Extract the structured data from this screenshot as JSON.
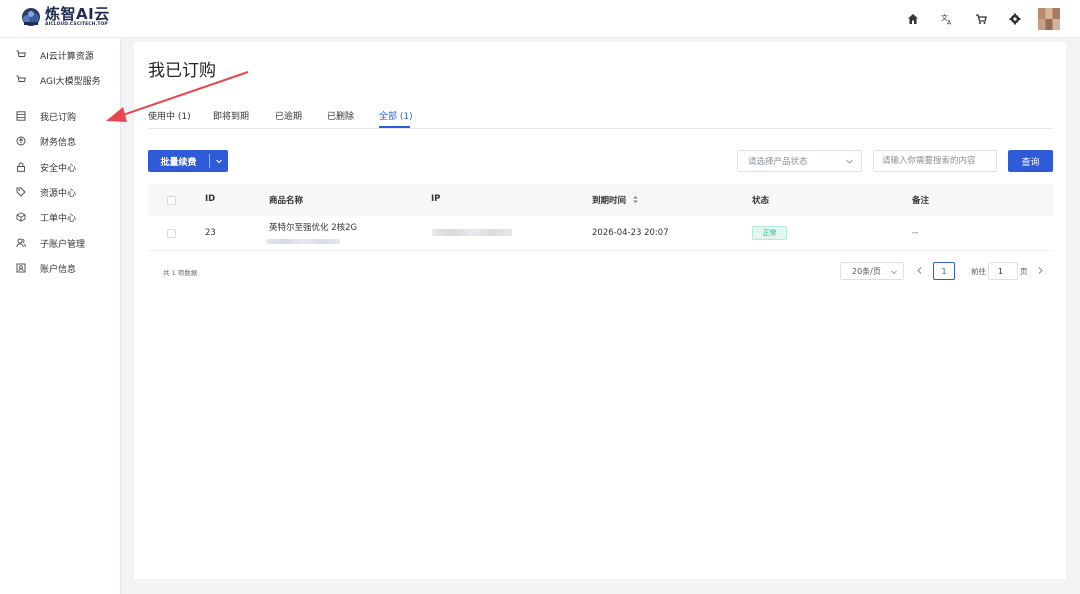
{
  "brand": {
    "name": "炼智AI云",
    "sub": "AICLOUD.CSCITECH.TOP"
  },
  "topbar": {
    "icons": [
      "home-icon",
      "translate-icon",
      "cart-icon",
      "settings-icon",
      "avatar"
    ]
  },
  "sidebar": {
    "items": [
      {
        "label": "AI云计算资源",
        "icon": "cart-icon"
      },
      {
        "label": "AGI大模型服务",
        "icon": "cart-icon"
      },
      {
        "label": "我已订购",
        "icon": "list-icon"
      },
      {
        "label": "财务信息",
        "icon": "arrow-circle-icon"
      },
      {
        "label": "安全中心",
        "icon": "lock-icon"
      },
      {
        "label": "资源中心",
        "icon": "tag-icon"
      },
      {
        "label": "工单中心",
        "icon": "cube-icon"
      },
      {
        "label": "子账户管理",
        "icon": "users-icon"
      },
      {
        "label": "账户信息",
        "icon": "id-card-icon"
      }
    ]
  },
  "page": {
    "title": "我已订购"
  },
  "tabs": [
    {
      "label": "使用中 (1)"
    },
    {
      "label": "即将到期"
    },
    {
      "label": "已逾期"
    },
    {
      "label": "已删除"
    },
    {
      "label": "全部 (1)",
      "active": true
    }
  ],
  "toolbar": {
    "batch_renew": "批量续费",
    "status_select_placeholder": "请选择产品状态",
    "search_placeholder": "请输入你需要搜索的内容",
    "query": "查询"
  },
  "table": {
    "columns": [
      "ID",
      "商品名称",
      "IP",
      "到期时间",
      "状态",
      "备注"
    ],
    "rows": [
      {
        "id": "23",
        "product": "英特尔至强优化 2核2G",
        "ip": "",
        "expire": "2026-04-23 20:07",
        "status": "正常",
        "note": "--"
      }
    ]
  },
  "pagination": {
    "total": "共 1 项数据",
    "page_size": "20条/页",
    "current_page": "1",
    "goto_prefix": "前往",
    "goto_value": "1",
    "goto_suffix": "页"
  },
  "colors": {
    "primary": "#2f5bd8",
    "annotation_arrow": "#e8474f",
    "status_green": "#2bb592"
  }
}
